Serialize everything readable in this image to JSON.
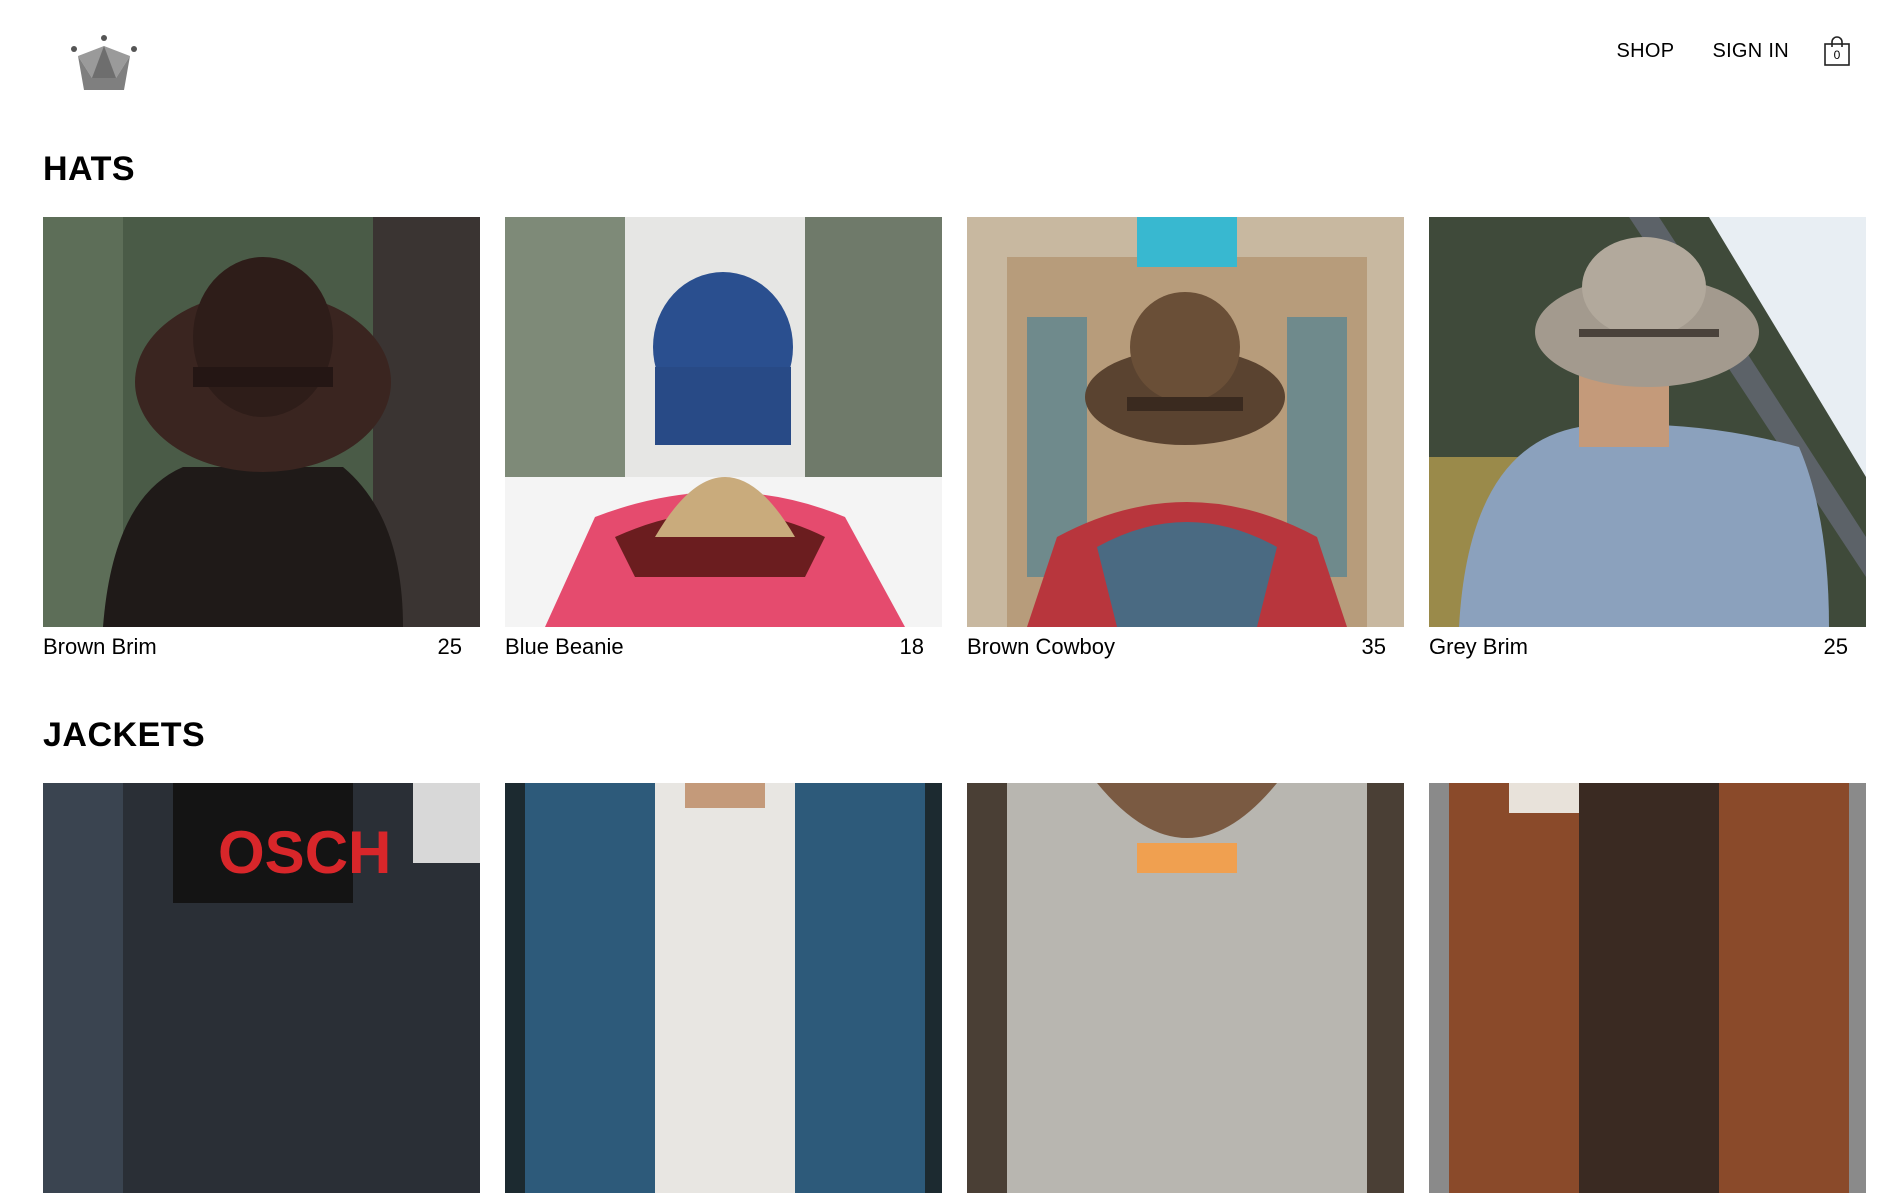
{
  "header": {
    "logo_icon": "crown-icon",
    "nav": {
      "shop_label": "SHOP",
      "signin_label": "SIGN IN"
    },
    "cart": {
      "icon": "shopping-bag-icon",
      "count": "0"
    }
  },
  "sections": [
    {
      "title": "HATS",
      "items": [
        {
          "name": "Brown Brim",
          "price": "25"
        },
        {
          "name": "Blue Beanie",
          "price": "18"
        },
        {
          "name": "Brown Cowboy",
          "price": "35"
        },
        {
          "name": "Grey Brim",
          "price": "25"
        }
      ]
    },
    {
      "title": "JACKETS",
      "items": [
        {
          "name": "",
          "price": ""
        },
        {
          "name": "",
          "price": ""
        },
        {
          "name": "",
          "price": ""
        },
        {
          "name": "",
          "price": ""
        }
      ]
    }
  ],
  "colors": {
    "text": "#000000",
    "background": "#ffffff",
    "logo_grey": "#808080"
  }
}
